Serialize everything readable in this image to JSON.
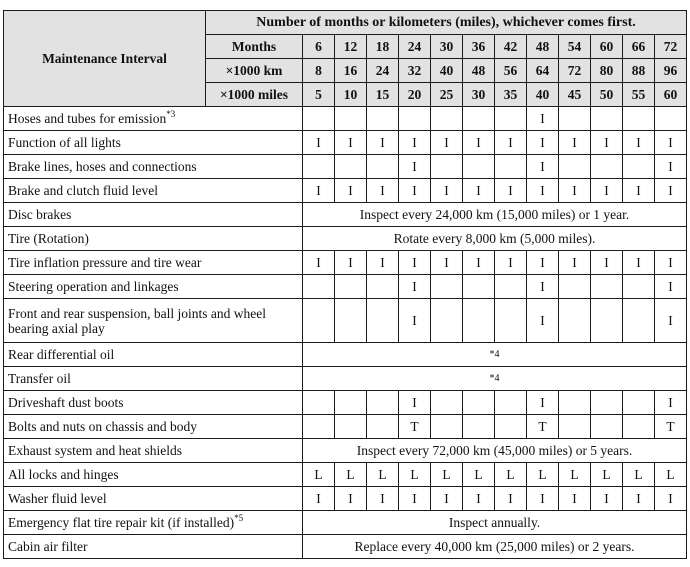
{
  "header": {
    "title": "Maintenance Interval",
    "span_title": "Number of months or kilometers (miles), whichever comes first.",
    "rows": [
      {
        "label": "Months",
        "values": [
          "6",
          "12",
          "18",
          "24",
          "30",
          "36",
          "42",
          "48",
          "54",
          "60",
          "66",
          "72"
        ]
      },
      {
        "label": "×1000 km",
        "values": [
          "8",
          "16",
          "24",
          "32",
          "40",
          "48",
          "56",
          "64",
          "72",
          "80",
          "88",
          "96"
        ]
      },
      {
        "label": "×1000 miles",
        "values": [
          "5",
          "10",
          "15",
          "20",
          "25",
          "30",
          "35",
          "40",
          "45",
          "50",
          "55",
          "60"
        ]
      }
    ]
  },
  "items": [
    {
      "name": "Hoses and tubes for emission",
      "note": "*3",
      "cells": [
        "",
        "",
        "",
        "",
        "",
        "",
        "",
        "I",
        "",
        "",
        "",
        ""
      ]
    },
    {
      "name": "Function of all lights",
      "note": "",
      "cells": [
        "I",
        "I",
        "I",
        "I",
        "I",
        "I",
        "I",
        "I",
        "I",
        "I",
        "I",
        "I"
      ]
    },
    {
      "name": "Brake lines, hoses and connections",
      "note": "",
      "cells": [
        "",
        "",
        "",
        "I",
        "",
        "",
        "",
        "I",
        "",
        "",
        "",
        "I"
      ]
    },
    {
      "name": "Brake and clutch fluid level",
      "note": "",
      "cells": [
        "I",
        "I",
        "I",
        "I",
        "I",
        "I",
        "I",
        "I",
        "I",
        "I",
        "I",
        "I"
      ]
    },
    {
      "name": "Disc brakes",
      "note": "",
      "span": "Inspect every 24,000 km (15,000 miles) or 1 year."
    },
    {
      "name": "Tire (Rotation)",
      "note": "",
      "span": "Rotate every 8,000 km (5,000 miles)."
    },
    {
      "name": "Tire inflation pressure and tire wear",
      "note": "",
      "cells": [
        "I",
        "I",
        "I",
        "I",
        "I",
        "I",
        "I",
        "I",
        "I",
        "I",
        "I",
        "I"
      ]
    },
    {
      "name": "Steering operation and linkages",
      "note": "",
      "cells": [
        "",
        "",
        "",
        "I",
        "",
        "",
        "",
        "I",
        "",
        "",
        "",
        "I"
      ]
    },
    {
      "name": "Front and rear suspension, ball joints and wheel bearing axial play",
      "note": "",
      "tall": true,
      "cells": [
        "",
        "",
        "",
        "I",
        "",
        "",
        "",
        "I",
        "",
        "",
        "",
        "I"
      ]
    },
    {
      "name": "Rear differential oil",
      "note": "",
      "span": "*4"
    },
    {
      "name": "Transfer oil",
      "note": "",
      "span": "*4"
    },
    {
      "name": "Driveshaft dust boots",
      "note": "",
      "cells": [
        "",
        "",
        "",
        "I",
        "",
        "",
        "",
        "I",
        "",
        "",
        "",
        "I"
      ]
    },
    {
      "name": "Bolts and nuts on chassis and body",
      "note": "",
      "cells": [
        "",
        "",
        "",
        "T",
        "",
        "",
        "",
        "T",
        "",
        "",
        "",
        "T"
      ]
    },
    {
      "name": "Exhaust system and heat shields",
      "note": "",
      "span": "Inspect every 72,000 km (45,000 miles) or 5 years."
    },
    {
      "name": "All locks and hinges",
      "note": "",
      "cells": [
        "L",
        "L",
        "L",
        "L",
        "L",
        "L",
        "L",
        "L",
        "L",
        "L",
        "L",
        "L"
      ]
    },
    {
      "name": "Washer fluid level",
      "note": "",
      "cells": [
        "I",
        "I",
        "I",
        "I",
        "I",
        "I",
        "I",
        "I",
        "I",
        "I",
        "I",
        "I"
      ]
    },
    {
      "name": "Emergency flat tire repair kit (if installed)",
      "note": "*5",
      "span": "Inspect annually."
    },
    {
      "name": "Cabin air filter",
      "note": "",
      "span": "Replace every 40,000 km (25,000 miles) or 2 years."
    }
  ]
}
